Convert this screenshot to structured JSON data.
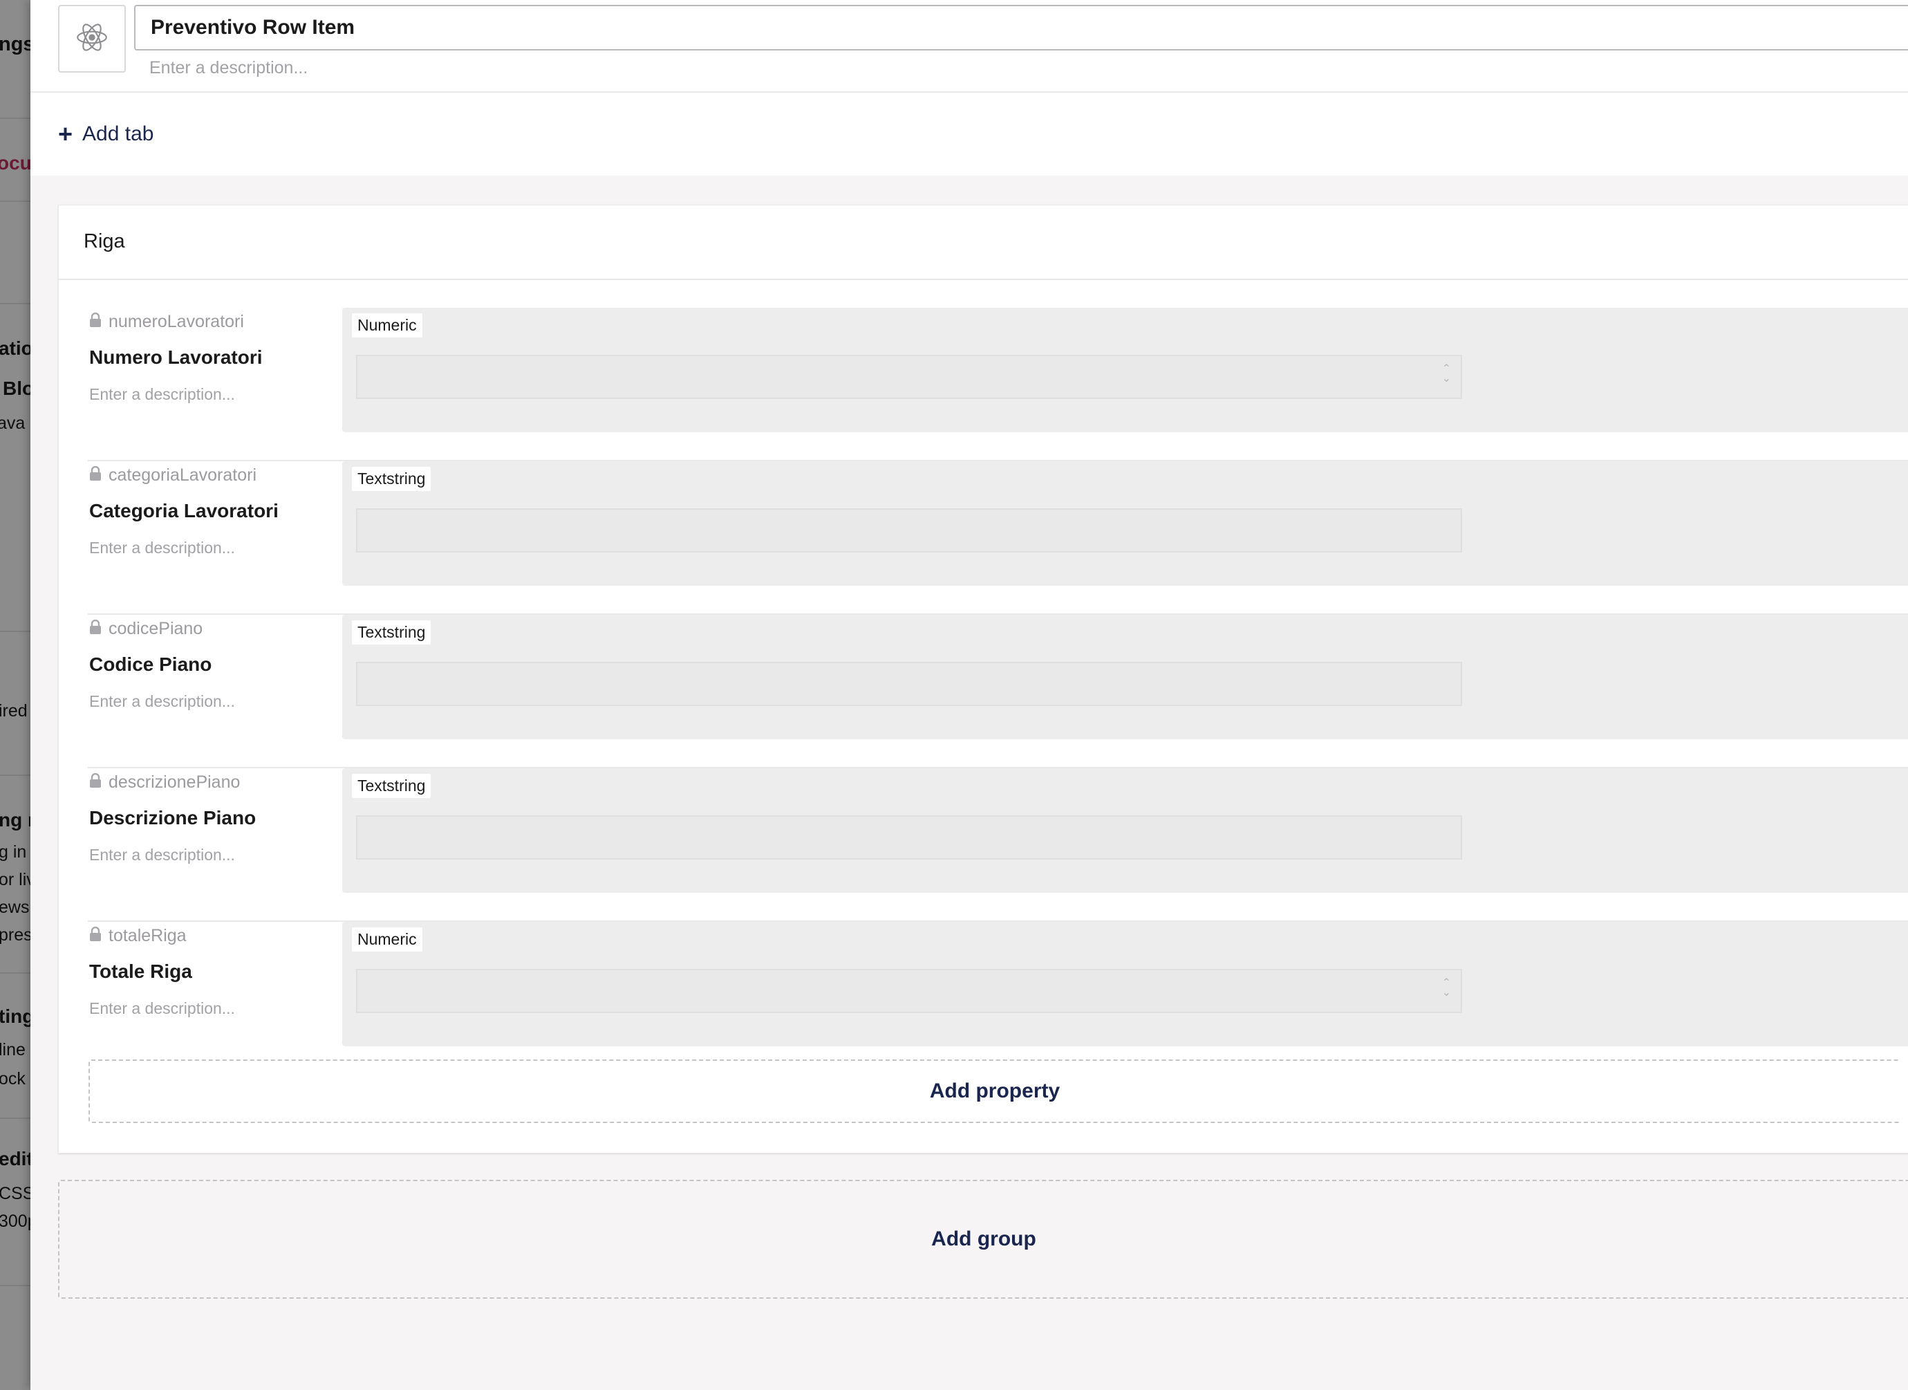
{
  "background": {
    "fragments": [
      "ngs",
      "ocu",
      "atio",
      "Blo",
      "ava",
      "ired",
      "ng r",
      "g in",
      "or liv",
      "ews",
      "pres",
      "ting",
      "line",
      "ock v",
      "edit",
      "CSS",
      "300p"
    ]
  },
  "editor": {
    "name": "Preventivo Row Item",
    "description_placeholder": "Enter a description...",
    "icon": "atom-icon",
    "add_tab_label": "Add tab",
    "group": {
      "name": "Riga",
      "properties": [
        {
          "alias": "numeroLavoratori",
          "label": "Numero Lavoratori",
          "description_placeholder": "Enter a description...",
          "editor": "Numeric"
        },
        {
          "alias": "categoriaLavoratori",
          "label": "Categoria Lavoratori",
          "description_placeholder": "Enter a description...",
          "editor": "Textstring"
        },
        {
          "alias": "codicePiano",
          "label": "Codice Piano",
          "description_placeholder": "Enter a description...",
          "editor": "Textstring"
        },
        {
          "alias": "descrizionePiano",
          "label": "Descrizione Piano",
          "description_placeholder": "Enter a description...",
          "editor": "Textstring"
        },
        {
          "alias": "totaleRiga",
          "label": "Totale Riga",
          "description_placeholder": "Enter a description...",
          "editor": "Numeric"
        }
      ],
      "add_property_label": "Add property"
    },
    "add_group_label": "Add group"
  },
  "colors": {
    "accent": "#1b264f",
    "panel_bg": "#f6f4f4",
    "editor_bg": "#ededed",
    "muted_text": "#a2a1a6",
    "background_link": "#c3325f"
  }
}
